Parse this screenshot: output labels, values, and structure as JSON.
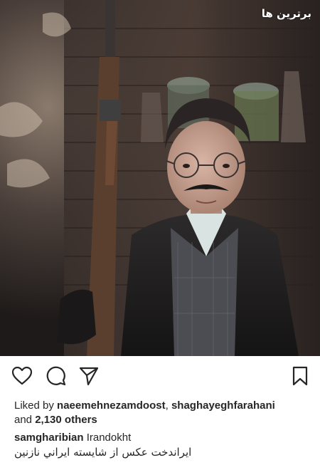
{
  "photo": {
    "description_icon": "photo-of-man-with-rifle",
    "watermark": "برترین ها"
  },
  "actions": {
    "like_icon": "heart-icon",
    "comment_icon": "comment-icon",
    "share_icon": "send-icon",
    "save_icon": "bookmark-icon"
  },
  "likes": {
    "prefix": "Liked by",
    "user1": "naeemehnezamdoost",
    "separator": ",",
    "user2": "shaghayeghfarahani",
    "and": "and",
    "others": "2,130 others"
  },
  "caption": {
    "username": "samgharibian",
    "text": "Irandokht",
    "text_rtl": "ايراندخت عكس از شايسته ايراني نازنين"
  },
  "colors": {
    "text": "#262626",
    "background": "#ffffff"
  }
}
